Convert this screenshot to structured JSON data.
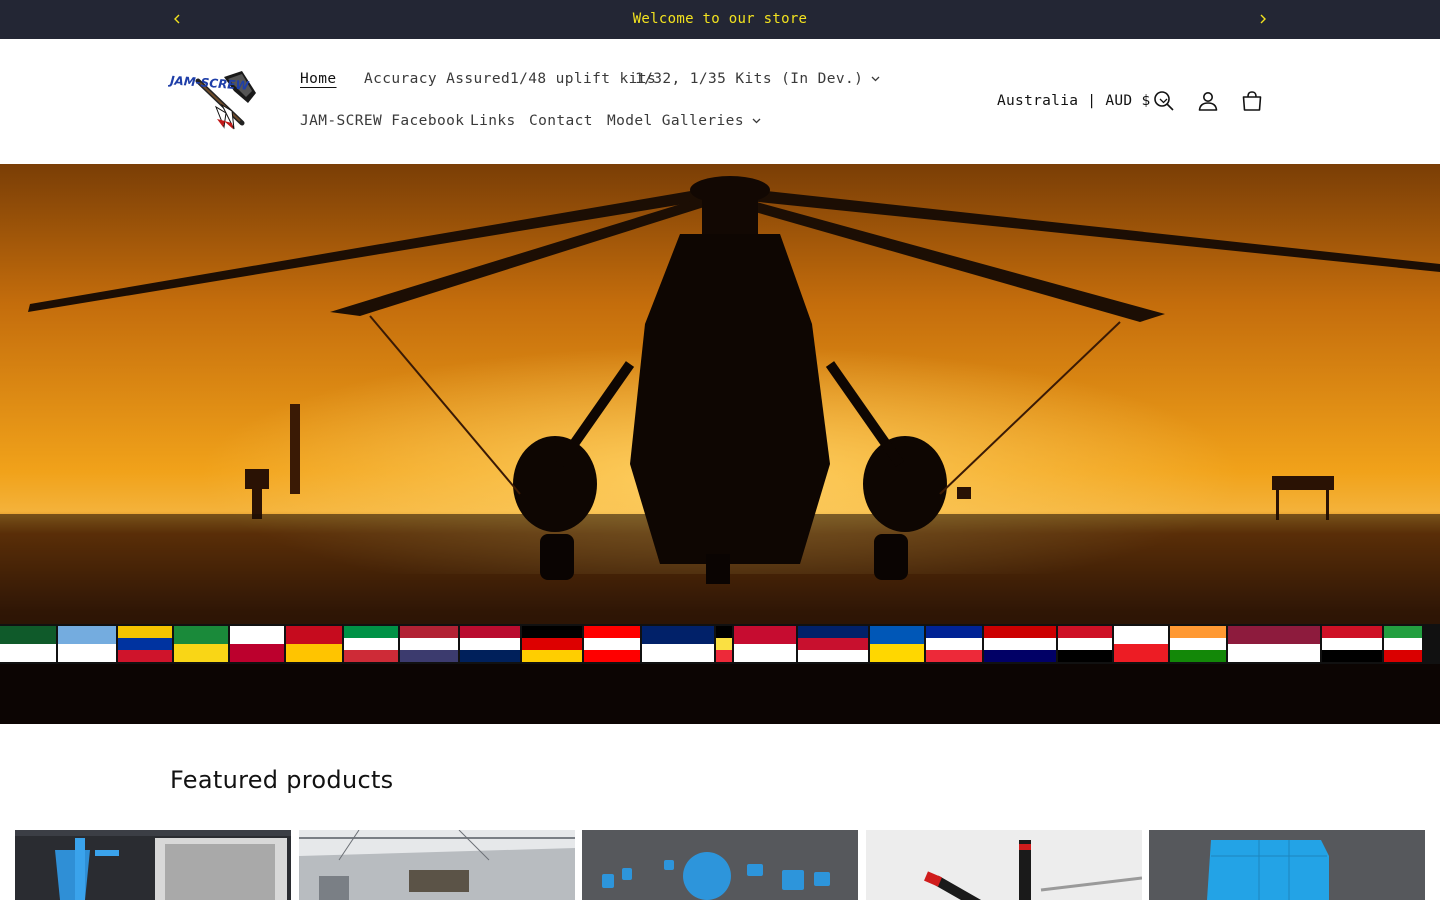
{
  "announcement": {
    "message": "Welcome to our store",
    "text_color": "#f2e21f",
    "background": "#232634",
    "prev_icon": "chevron-left-icon",
    "next_icon": "chevron-right-icon"
  },
  "header": {
    "logo_text": "JAM-SCREW",
    "nav": [
      {
        "label": "Home",
        "active": true
      },
      {
        "label": "Accuracy Assured"
      },
      {
        "label": "1/48 uplift kits"
      },
      {
        "label": "1/32, 1/35 Kits (In Dev.)",
        "dropdown": true
      },
      {
        "label": "JAM-SCREW Facebook"
      },
      {
        "label": "Links"
      },
      {
        "label": "Contact"
      },
      {
        "label": "Model Galleries",
        "dropdown": true
      }
    ],
    "country_selector": "Australia | AUD $",
    "icons": [
      "search-icon",
      "account-icon",
      "cart-icon"
    ]
  },
  "hero": {
    "image": "helicopter-silhouette-sunset-with-flags",
    "sky_colors": [
      "#f0a21c",
      "#8a4a0a",
      "#3a1d08"
    ]
  },
  "featured": {
    "title": "Featured products",
    "products": [
      {
        "image": "3d-render-screenshot"
      },
      {
        "image": "hangar-photo"
      },
      {
        "image": "blue-parts-render"
      },
      {
        "image": "rotor-rods-photo"
      },
      {
        "image": "blue-panel-render"
      }
    ]
  }
}
